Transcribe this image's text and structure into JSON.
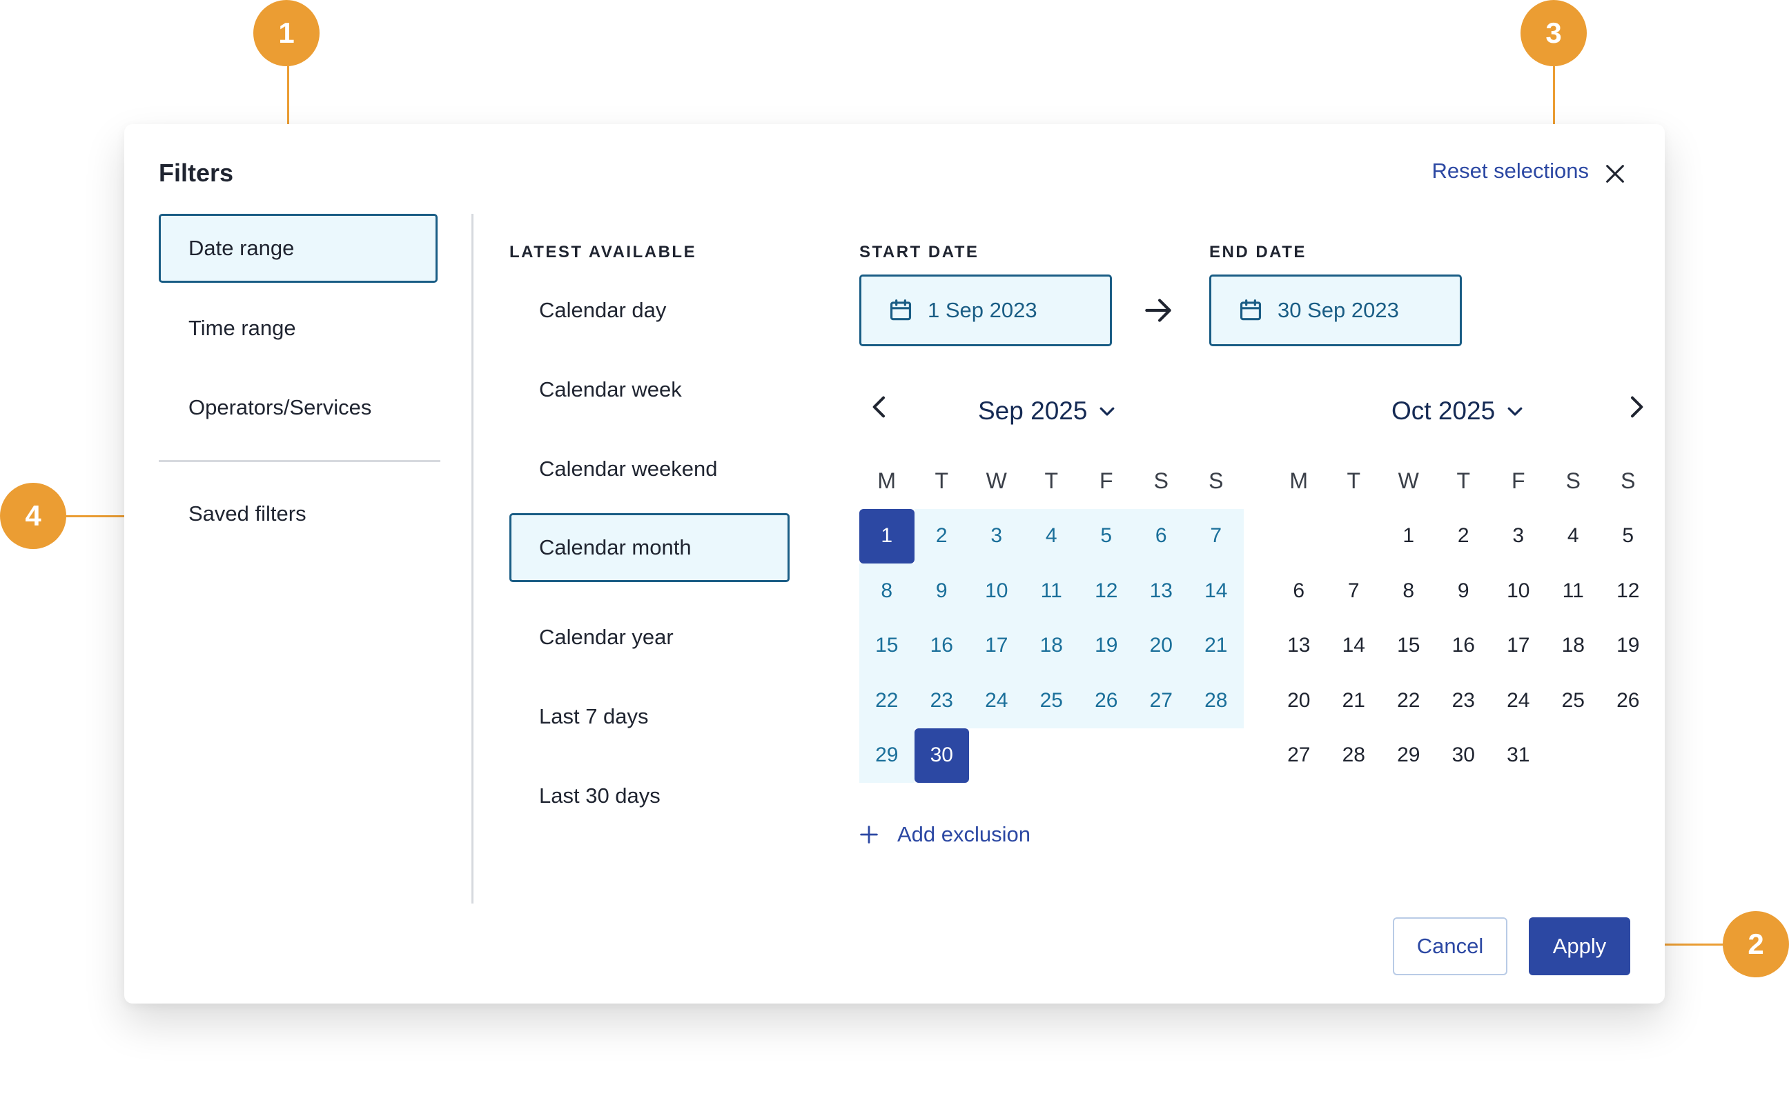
{
  "header": {
    "title": "Filters",
    "reset_label": "Reset selections"
  },
  "nav": {
    "items": [
      {
        "label": "Date range",
        "active": true
      },
      {
        "label": "Time range",
        "active": false
      },
      {
        "label": "Operators/Services",
        "active": false
      }
    ],
    "saved_label": "Saved filters"
  },
  "latest": {
    "heading": "LATEST AVAILABLE",
    "options": [
      {
        "label": "Calendar day",
        "active": false
      },
      {
        "label": "Calendar week",
        "active": false
      },
      {
        "label": "Calendar weekend",
        "active": false
      },
      {
        "label": "Calendar month",
        "active": true
      },
      {
        "label": "Calendar year",
        "active": false
      },
      {
        "label": "Last 7 days",
        "active": false
      },
      {
        "label": "Last 30 days",
        "active": false
      }
    ]
  },
  "range": {
    "start_heading": "START DATE",
    "start_value": "1 Sep 2023",
    "end_heading": "END DATE",
    "end_value": "30 Sep 2023"
  },
  "calendars": [
    {
      "month_label": "Sep 2025",
      "weekdays": [
        "M",
        "T",
        "W",
        "T",
        "F",
        "S",
        "S"
      ],
      "offset": 0,
      "days": 30,
      "selected_start": 1,
      "selected_end": 30
    },
    {
      "month_label": "Oct 2025",
      "weekdays": [
        "M",
        "T",
        "W",
        "T",
        "F",
        "S",
        "S"
      ],
      "offset": 2,
      "days": 31,
      "selected_start": null,
      "selected_end": null
    }
  ],
  "add_exclusion_label": "Add exclusion",
  "footer": {
    "cancel_label": "Cancel",
    "apply_label": "Apply"
  },
  "callouts": [
    "1",
    "2",
    "3",
    "4"
  ],
  "colors": {
    "accent": "#2c48a3",
    "selected_border": "#1a5d85",
    "selected_bg": "#ebf8fd",
    "range_text": "#1a6f9a",
    "callout": "#eb9d33"
  }
}
